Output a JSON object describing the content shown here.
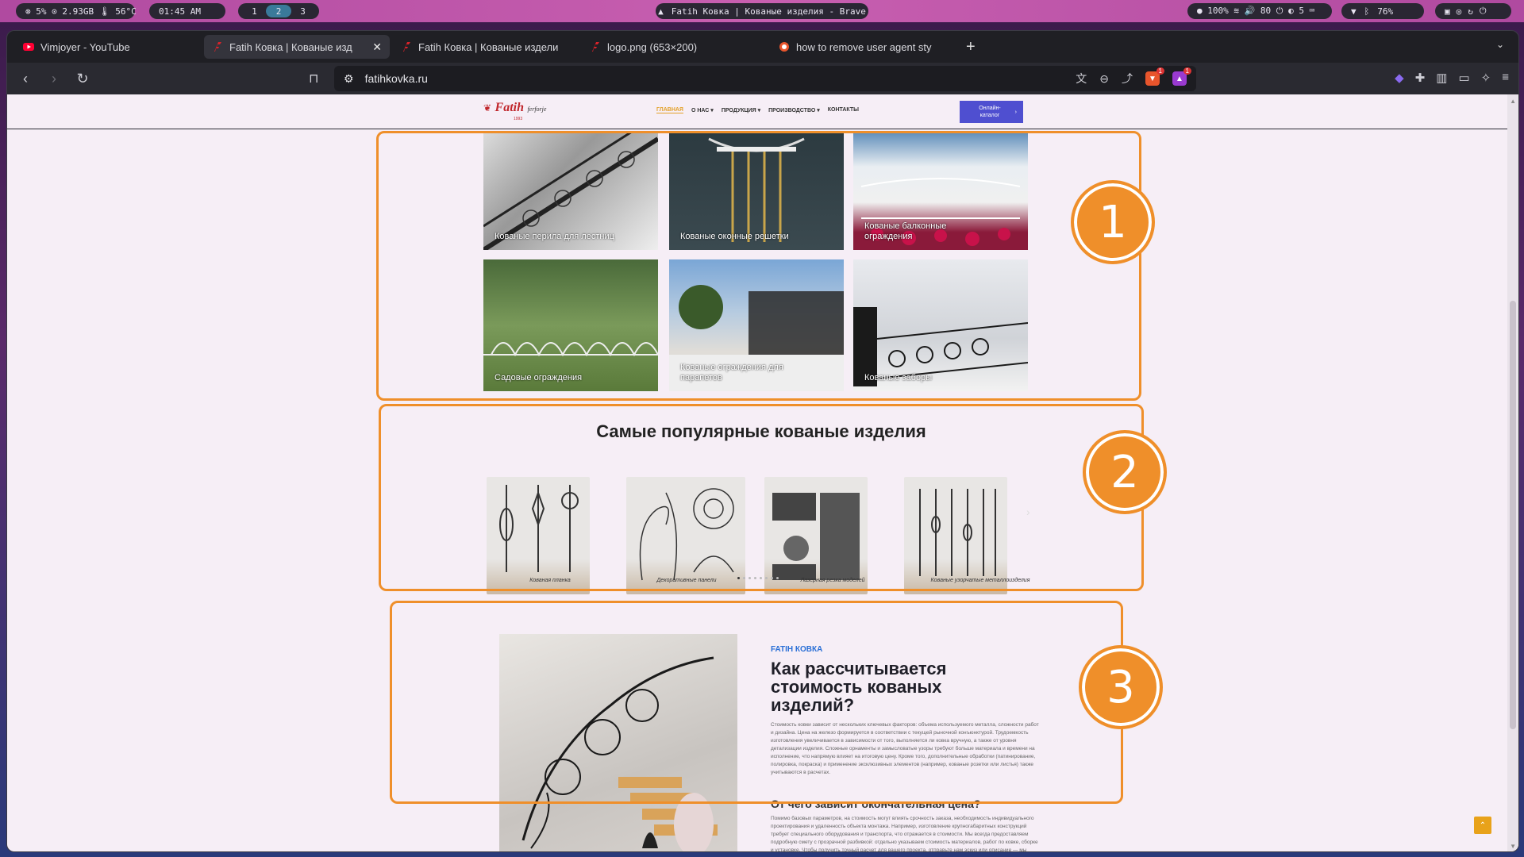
{
  "wm": {
    "stats": "⊗ 5%  ⊙ 2.93GB  🌡 56°C",
    "clock": "01:45 AM",
    "workspaces": [
      "1",
      "2",
      "3"
    ],
    "window_title": "Fatih Ковка | Кованые изделия - Brave",
    "sys": "● 100%  ≋  🔊 80  ⏻  ◐ 5  ⌨",
    "battery": "76%"
  },
  "browser": {
    "tabs": [
      {
        "title": "Vimjoyer - YouTube",
        "favicon": "youtube-icon",
        "active": false
      },
      {
        "title": "Fatih Ковка | Кованые изд",
        "favicon": "fatih-icon",
        "active": true
      },
      {
        "title": "Fatih Ковка | Кованые издели",
        "favicon": "fatih-icon",
        "active": false
      },
      {
        "title": "logo.png (653×200)",
        "favicon": "fatih-icon",
        "active": false
      },
      {
        "title": "how to remove user agent sty",
        "favicon": "brave-search-icon",
        "active": false
      }
    ],
    "url": "fatihkovka.ru",
    "shield_badge": "1",
    "rewards_badge": "1"
  },
  "site": {
    "logo_text": "Fatih",
    "logo_sub": "ferforje",
    "logo_year": "1993",
    "nav": [
      "ГЛАВНАЯ",
      "О НАС ▾",
      "ПРОДУКЦИЯ ▾",
      "ПРОИЗВОДСТВО ▾",
      "КОНТАКТЫ"
    ],
    "catalog_btn": "Онлайн-каталог",
    "grid": [
      {
        "caption": "Кованые перила для лестниц"
      },
      {
        "caption": "Кованые оконные решетки"
      },
      {
        "caption": "Кованые балконные ограждения"
      },
      {
        "caption": "Садовые ограждения"
      },
      {
        "caption": "Кованые ограждения для парапетов"
      },
      {
        "caption": "Кованые заборы"
      }
    ],
    "popular_title": "Самые популярные кованые изделия",
    "popular": [
      {
        "label": "Кованая планка"
      },
      {
        "label": "Декоративные панели"
      },
      {
        "label": "Лазерная резка моделей"
      },
      {
        "label": "Кованые узорчатые металлоизделия"
      }
    ],
    "kicker": "FATIH КОВКА",
    "article_title": "Как рассчитывается стоимость кованых изделий?",
    "article_p1": "Стоимость ковки зависит от нескольких ключевых факторов: объема используемого металла, сложности работ и дизайна. Цена на железо формируется в соответствии с текущей рыночной конъюнктурой. Трудоемкость изготовления увеличивается в зависимости от того, выполняется ли ковка вручную, а также от уровня детализации изделия. Сложные орнаменты и замысловатые узоры требуют больше материала и времени на исполнение, что напрямую влияет на итоговую цену. Кроме того, дополнительные обработки (патинирование, полировка, покраска) и применение эксклюзивных элементов (например, кованые розетки или листья) также учитываются в расчетах.",
    "article_h2": "От чего зависит окончательная цена?",
    "article_p2": "Помимо базовых параметров, на стоимость могут влиять срочность заказа, необходимость индивидуального проектирования и удаленность объекта монтажа. Например, изготовление крупногабаритных конструкций требует специального оборудования и транспорта, что отражается в стоимости. Мы всегда предоставляем подробную смету с прозрачной разбивкой: отдельно указываем стоимость материалов, работ по ковке, сборке и установке. Чтобы получить точный расчет для вашего проекта, отправьте нам эскиз или описание — мы подготовим оптимальное предложение с учетом вашего бюджета и пожеланий!"
  },
  "annotations": [
    "1",
    "2",
    "3"
  ],
  "colors": {
    "accent": "#ef8f2a",
    "kicker": "#2a6fd6",
    "catalog": "#4f4fd0"
  }
}
